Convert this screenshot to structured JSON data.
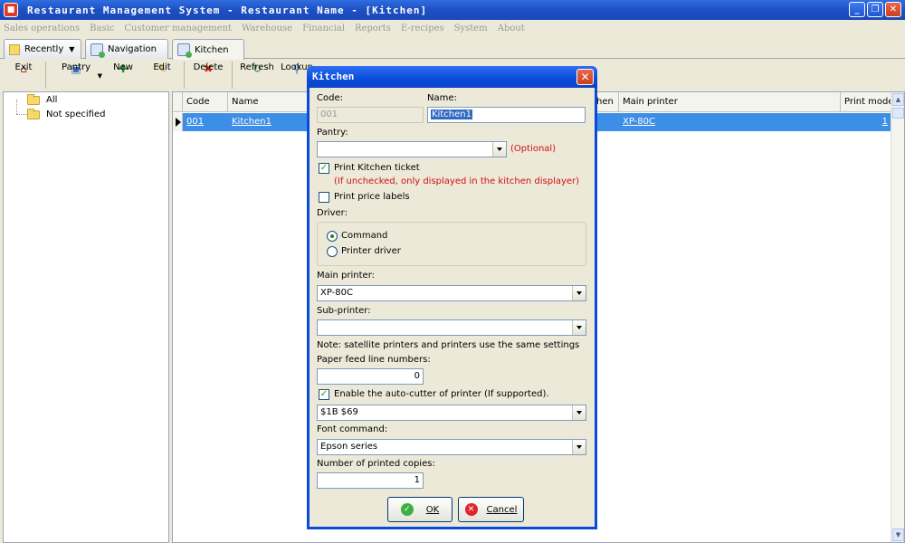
{
  "window": {
    "title": "Restaurant Management System - Restaurant Name - [Kitchen]",
    "minimize": "_",
    "restore": "❐",
    "close": "✕"
  },
  "menu": [
    "Sales operations",
    "Basic",
    "Customer management",
    "Warehouse",
    "Financial",
    "Reports",
    "E-recipes",
    "System",
    "About"
  ],
  "tabs": {
    "recently": "Recently",
    "navigation": "Navigation",
    "kitchen": "Kitchen"
  },
  "toolbar": {
    "exit": "Exit",
    "pantry": "Pantry",
    "new": "New",
    "edit": "Edit",
    "delete": "Delete",
    "refresh": "Refresh",
    "lookup": "Lookup"
  },
  "tree": {
    "all": "All",
    "not_specified": "Not specified"
  },
  "grid": {
    "columns": {
      "code": "Code",
      "name": "Name",
      "pantry_partial": "hen",
      "main_printer": "Main printer",
      "print_mode": "Print mode"
    },
    "rows": [
      {
        "code": "001",
        "name": "Kitchen1",
        "main_printer": "XP-80C",
        "print_mode": "1"
      }
    ]
  },
  "dialog": {
    "title": "Kitchen",
    "close": "✕",
    "code_label": "Code:",
    "code_value": "001",
    "name_label": "Name:",
    "name_value": "Kitchen1",
    "pantry_label": "Pantry:",
    "pantry_value": "",
    "optional": "(Optional)",
    "print_ticket_label": "Print Kitchen ticket",
    "print_ticket_checked": true,
    "print_ticket_note": "(If unchecked, only displayed in the kitchen displayer)",
    "print_price_label": "Print price labels",
    "print_price_checked": false,
    "driver_label": "Driver:",
    "driver_command": "Command",
    "driver_printer": "Printer driver",
    "driver_selected": "Command",
    "main_printer_label": "Main printer:",
    "main_printer_value": "XP-80C",
    "sub_printer_label": "Sub-printer:",
    "sub_printer_value": "",
    "note": "Note: satellite printers and printers use the same settings",
    "paper_feed_label": "Paper feed line numbers:",
    "paper_feed_value": "0",
    "auto_cutter_label": "Enable the auto-cutter of printer (If supported).",
    "auto_cutter_checked": true,
    "cutter_command_value": "$1B $69",
    "font_command_label": "Font command:",
    "font_command_value": "Epson series",
    "copies_label": "Number of printed copies:",
    "copies_value": "1",
    "ok": "OK",
    "cancel": "Cancel"
  }
}
